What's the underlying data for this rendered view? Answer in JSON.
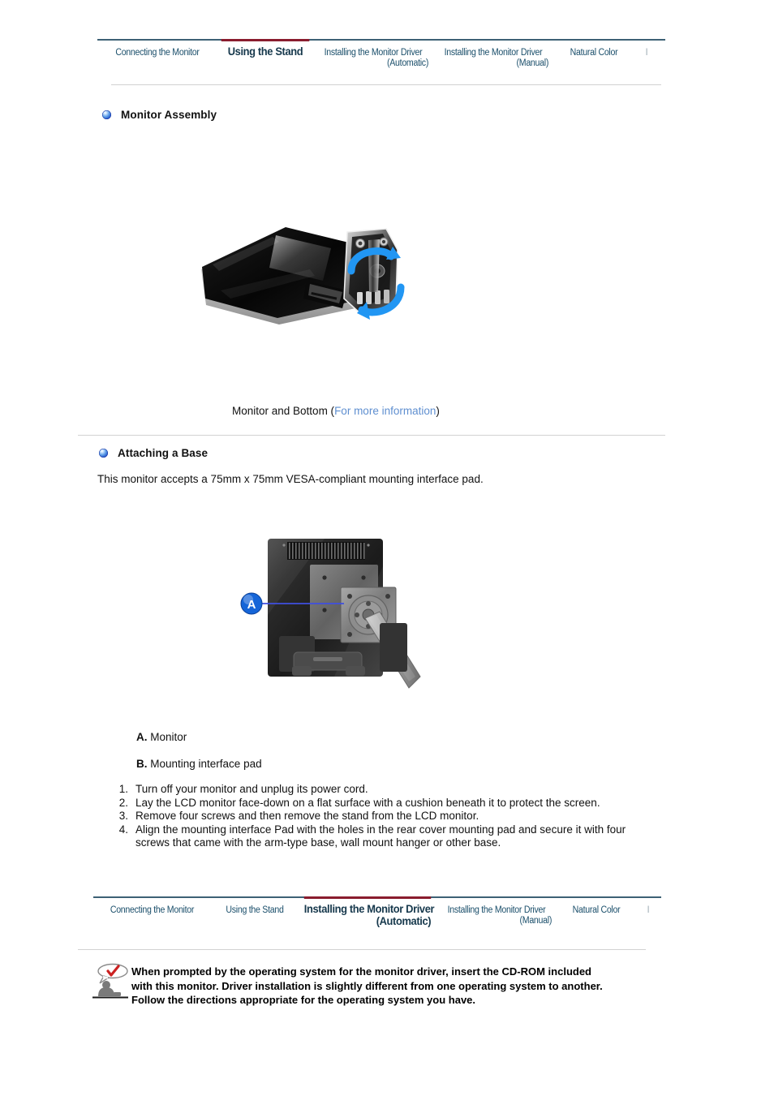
{
  "nav_top": {
    "active_underline_color": "#8a1c2e",
    "rule_color": "#3d6175",
    "items": [
      {
        "line1": "Connecting  the Monitor",
        "line2": "",
        "active": false
      },
      {
        "line1": "Using the Stand",
        "line2": "",
        "active": true
      },
      {
        "line1": "Installing the Monitor Driver",
        "line2": "(Automatic)",
        "active": false
      },
      {
        "line1": "Installing the Monitor Driver",
        "line2": "(Manual)",
        "active": false
      },
      {
        "line1": "Natural Color",
        "line2": "",
        "active": false
      },
      {
        "line1": "I",
        "line2": "",
        "active": false
      }
    ]
  },
  "nav_bottom": {
    "items": [
      {
        "line1": "Connecting  the Monitor",
        "line2": "",
        "active": false
      },
      {
        "line1": "Using the Stand",
        "line2": "",
        "active": false
      },
      {
        "line1": "Installing the Monitor Driver",
        "line2": "(Automatic)",
        "active": true
      },
      {
        "line1": "Installing the Monitor Driver",
        "line2": "(Manual)",
        "active": false
      },
      {
        "line1": "Natural Color",
        "line2": "",
        "active": false
      },
      {
        "line1": "I",
        "line2": "",
        "active": false
      }
    ]
  },
  "section_assembly": {
    "title": "Monitor Assembly",
    "caption_prefix": "Monitor and Bottom (",
    "caption_link": "For more information",
    "caption_suffix": ")"
  },
  "section_base": {
    "title": "Attaching a Base",
    "intro": "This monitor accepts a 75mm x 75mm VESA-compliant mounting interface pad.",
    "callout_letter": "A",
    "label_a_key": "A.",
    "label_a_text": " Monitor",
    "label_b_key": "B.",
    "label_b_text": " Mounting interface pad",
    "steps": [
      {
        "num": "1.",
        "text": "Turn off your monitor and unplug its power cord."
      },
      {
        "num": "2.",
        "text": "Lay the LCD monitor face-down on a flat surface with a cushion beneath it to protect the screen."
      },
      {
        "num": "3.",
        "text": "Remove four screws and then remove the stand from the LCD monitor."
      },
      {
        "num": "4.",
        "text": "Align the mounting interface Pad with the holes in the rear cover mounting pad and secure it with four screws that came with the arm-type base, wall mount hanger or other base."
      }
    ]
  },
  "note": {
    "text": "When prompted by the operating system for the monitor driver, insert the CD-ROM included with this monitor. Driver installation is slightly different from one operating system to another. Follow the directions appropriate for the operating system you have."
  },
  "colors": {
    "nav_link": "#1b4f6b",
    "nav_rule": "#3d6175",
    "active_bar": "#8a1c2e",
    "divider": "#d2d2d2",
    "link_blue": "#5f8fd0",
    "callout_blue": "#1565d8",
    "note_check_red": "#cc2222"
  }
}
